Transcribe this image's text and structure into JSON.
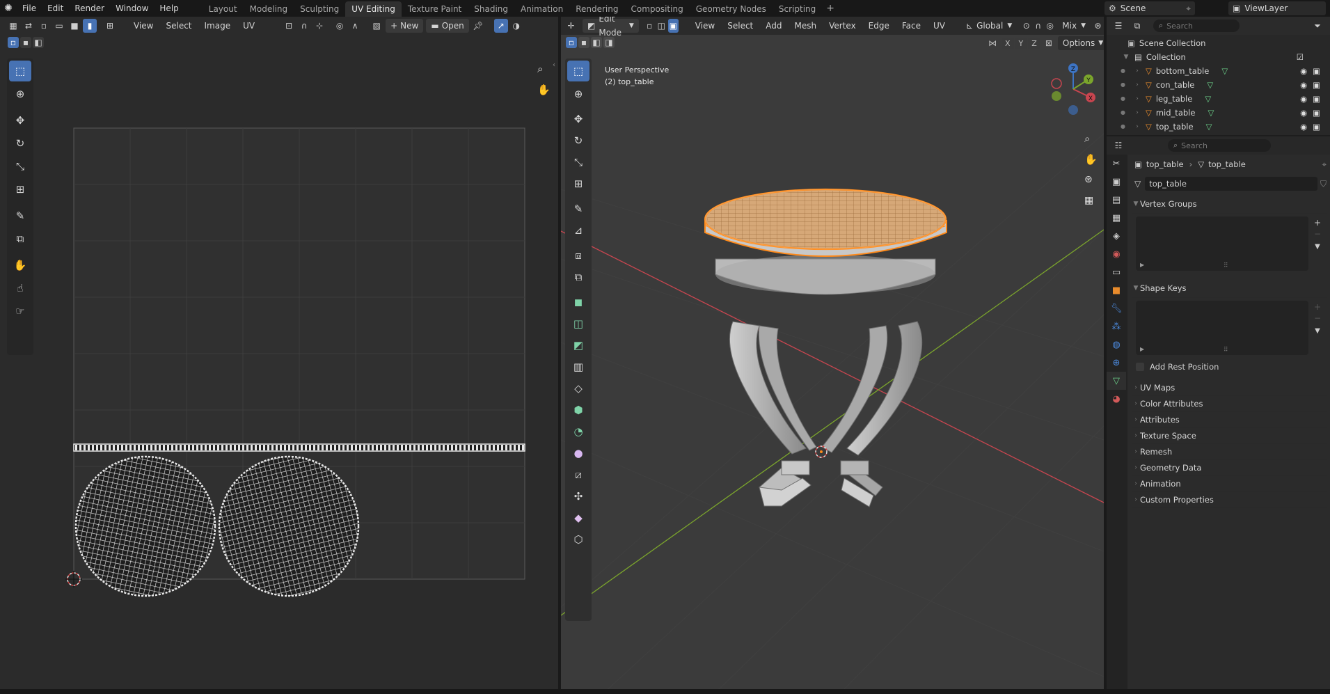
{
  "topbar": {
    "menus": [
      "File",
      "Edit",
      "Render",
      "Window",
      "Help"
    ],
    "workspaces": [
      "Layout",
      "Modeling",
      "Sculpting",
      "UV Editing",
      "Texture Paint",
      "Shading",
      "Animation",
      "Rendering",
      "Compositing",
      "Geometry Nodes",
      "Scripting"
    ],
    "active_workspace": "UV Editing",
    "add_tab": "+",
    "scene_label": "Scene",
    "viewlayer_label": "ViewLayer"
  },
  "uv_editor": {
    "menus": [
      "View",
      "Select",
      "Image",
      "UV"
    ],
    "new_label": "New",
    "open_label": "Open"
  },
  "viewport": {
    "mode": "Edit Mode",
    "menus": [
      "View",
      "Select",
      "Add",
      "Mesh",
      "Vertex",
      "Edge",
      "Face",
      "UV"
    ],
    "orientation": "Global",
    "shading_mix": "Mix",
    "options_label": "Options",
    "axes_labels": [
      "X",
      "Y",
      "Z"
    ],
    "overlay_line1": "User Perspective",
    "overlay_line2": "(2) top_table",
    "gizmo_labels": {
      "x": "X",
      "y": "Y",
      "z": "Z"
    }
  },
  "outliner": {
    "search_placeholder": "Search",
    "scene_collection": "Scene Collection",
    "collection": "Collection",
    "objects": [
      "bottom_table",
      "con_table",
      "leg_table",
      "mid_table",
      "top_table"
    ]
  },
  "properties": {
    "search_placeholder": "Search",
    "breadcrumb_object": "top_table",
    "breadcrumb_data": "top_table",
    "data_name": "top_table",
    "panels_open": [
      "Vertex Groups",
      "Shape Keys"
    ],
    "add_rest_position": "Add Rest Position",
    "panels_closed": [
      "UV Maps",
      "Color Attributes",
      "Attributes",
      "Texture Space",
      "Remesh",
      "Geometry Data",
      "Animation",
      "Custom Properties"
    ]
  },
  "colors": {
    "accent": "#4772b3",
    "selection_orange": "#ff8a1a",
    "x_axis": "#c8454f",
    "y_axis": "#7ba52c",
    "z_axis": "#3d74c4"
  }
}
